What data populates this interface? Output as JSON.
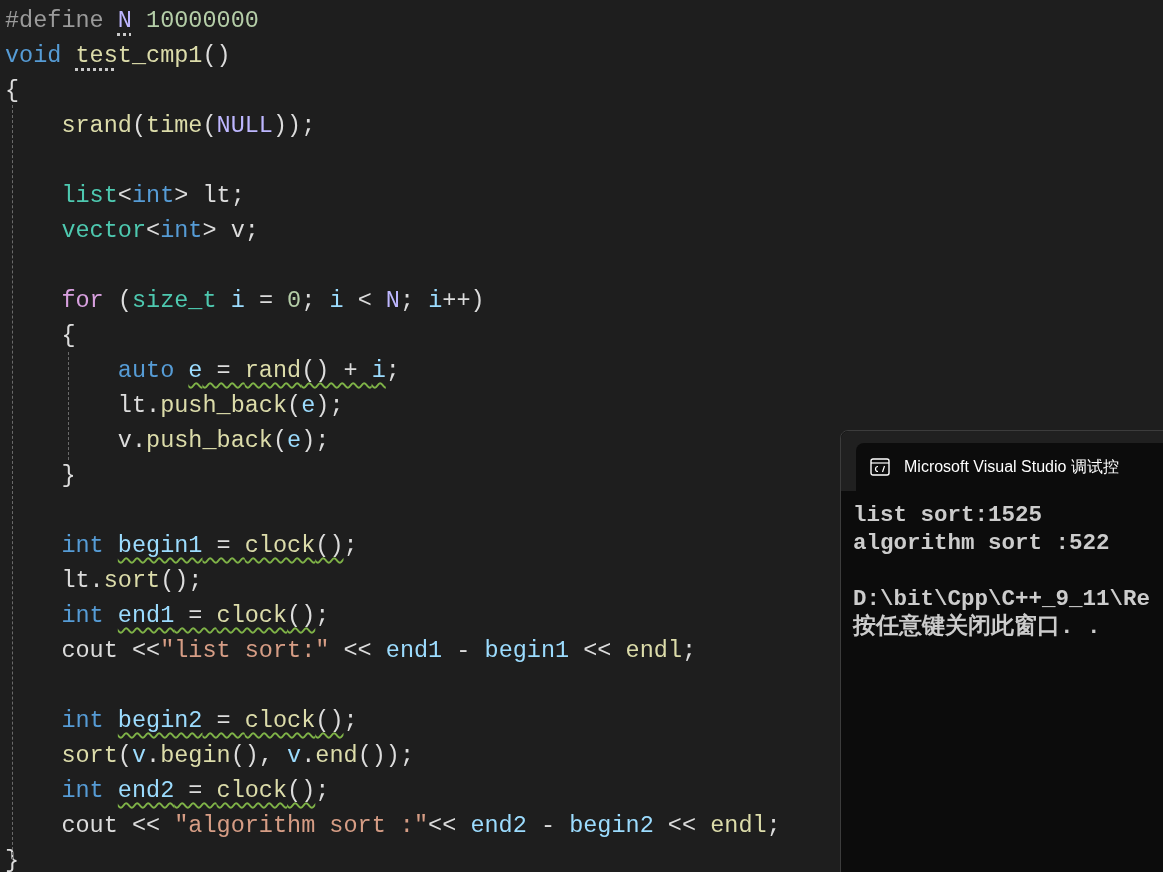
{
  "editor": {
    "lines": [
      {
        "kind": "code",
        "segments": [
          {
            "kind": "plain",
            "tokens": [
              {
                "text": "#define ",
                "kind": "preproc"
              }
            ]
          },
          {
            "kind": "hint",
            "tokens": [
              {
                "text": "N",
                "kind": "macro"
              }
            ]
          },
          {
            "kind": "plain",
            "tokens": [
              {
                "text": " 10000000",
                "kind": "number"
              }
            ]
          }
        ]
      },
      {
        "kind": "code",
        "segments": [
          {
            "kind": "plain",
            "tokens": [
              {
                "text": "void ",
                "kind": "keyword"
              }
            ]
          },
          {
            "kind": "hint",
            "tokens": [
              {
                "text": "tes",
                "kind": "func"
              }
            ]
          },
          {
            "kind": "plain",
            "tokens": [
              {
                "text": "t_cmp1",
                "kind": "func"
              },
              {
                "text": "()",
                "kind": "punct"
              }
            ]
          }
        ]
      },
      {
        "kind": "code",
        "segments": [
          {
            "kind": "plain",
            "tokens": [
              {
                "text": "{",
                "kind": "punct"
              }
            ]
          }
        ]
      },
      {
        "kind": "code",
        "segments": [
          {
            "kind": "plain",
            "tokens": [
              {
                "text": "    srand",
                "kind": "func"
              },
              {
                "text": "(",
                "kind": "punct"
              },
              {
                "text": "time",
                "kind": "func"
              },
              {
                "text": "(",
                "kind": "punct"
              },
              {
                "text": "NULL",
                "kind": "macro"
              },
              {
                "text": "));",
                "kind": "punct"
              }
            ]
          }
        ]
      },
      {
        "kind": "blank"
      },
      {
        "kind": "code",
        "segments": [
          {
            "kind": "plain",
            "tokens": [
              {
                "text": "    list",
                "kind": "type"
              },
              {
                "text": "<",
                "kind": "punct"
              },
              {
                "text": "int",
                "kind": "keyword"
              },
              {
                "text": "> lt;",
                "kind": "punct"
              }
            ]
          }
        ]
      },
      {
        "kind": "code",
        "segments": [
          {
            "kind": "plain",
            "tokens": [
              {
                "text": "    vector",
                "kind": "type"
              },
              {
                "text": "<",
                "kind": "punct"
              },
              {
                "text": "int",
                "kind": "keyword"
              },
              {
                "text": "> v;",
                "kind": "punct"
              }
            ]
          }
        ]
      },
      {
        "kind": "blank"
      },
      {
        "kind": "code",
        "segments": [
          {
            "kind": "plain",
            "tokens": [
              {
                "text": "    for",
                "kind": "control"
              },
              {
                "text": " (",
                "kind": "punct"
              },
              {
                "text": "size_t",
                "kind": "type"
              },
              {
                "text": " i",
                "kind": "var"
              },
              {
                "text": " = ",
                "kind": "punct"
              },
              {
                "text": "0",
                "kind": "number"
              },
              {
                "text": "; ",
                "kind": "punct"
              },
              {
                "text": "i",
                "kind": "var"
              },
              {
                "text": " < ",
                "kind": "punct"
              },
              {
                "text": "N",
                "kind": "macro"
              },
              {
                "text": "; ",
                "kind": "punct"
              },
              {
                "text": "i",
                "kind": "var"
              },
              {
                "text": "++)",
                "kind": "punct"
              }
            ]
          }
        ]
      },
      {
        "kind": "code",
        "segments": [
          {
            "kind": "plain",
            "tokens": [
              {
                "text": "    {",
                "kind": "punct"
              }
            ]
          }
        ]
      },
      {
        "kind": "code",
        "segments": [
          {
            "kind": "plain",
            "tokens": [
              {
                "text": "        auto ",
                "kind": "keyword"
              }
            ]
          },
          {
            "kind": "warning",
            "tokens": [
              {
                "text": "e",
                "kind": "var"
              },
              {
                "text": " = ",
                "kind": "punct"
              },
              {
                "text": "rand",
                "kind": "func"
              },
              {
                "text": "() + ",
                "kind": "punct"
              },
              {
                "text": "i",
                "kind": "var"
              }
            ]
          },
          {
            "kind": "plain",
            "tokens": [
              {
                "text": ";",
                "kind": "punct"
              }
            ]
          }
        ]
      },
      {
        "kind": "code",
        "segments": [
          {
            "kind": "plain",
            "tokens": [
              {
                "text": "        lt.",
                "kind": "punct"
              },
              {
                "text": "push_back",
                "kind": "func"
              },
              {
                "text": "(",
                "kind": "punct"
              },
              {
                "text": "e",
                "kind": "var"
              },
              {
                "text": ");",
                "kind": "punct"
              }
            ]
          }
        ]
      },
      {
        "kind": "code",
        "segments": [
          {
            "kind": "plain",
            "tokens": [
              {
                "text": "        v.",
                "kind": "punct"
              },
              {
                "text": "push_back",
                "kind": "func"
              },
              {
                "text": "(",
                "kind": "punct"
              },
              {
                "text": "e",
                "kind": "var"
              },
              {
                "text": ");",
                "kind": "punct"
              }
            ]
          }
        ]
      },
      {
        "kind": "code",
        "segments": [
          {
            "kind": "plain",
            "tokens": [
              {
                "text": "    }",
                "kind": "punct"
              }
            ]
          }
        ]
      },
      {
        "kind": "blank"
      },
      {
        "kind": "code",
        "segments": [
          {
            "kind": "plain",
            "tokens": [
              {
                "text": "    int ",
                "kind": "keyword"
              }
            ]
          },
          {
            "kind": "warning",
            "tokens": [
              {
                "text": "begin1",
                "kind": "var"
              },
              {
                "text": " = ",
                "kind": "punct"
              },
              {
                "text": "clock",
                "kind": "func"
              },
              {
                "text": "()",
                "kind": "punct"
              }
            ]
          },
          {
            "kind": "plain",
            "tokens": [
              {
                "text": ";",
                "kind": "punct"
              }
            ]
          }
        ]
      },
      {
        "kind": "code",
        "segments": [
          {
            "kind": "plain",
            "tokens": [
              {
                "text": "    lt.",
                "kind": "punct"
              },
              {
                "text": "sort",
                "kind": "func"
              },
              {
                "text": "();",
                "kind": "punct"
              }
            ]
          }
        ]
      },
      {
        "kind": "code",
        "segments": [
          {
            "kind": "plain",
            "tokens": [
              {
                "text": "    int ",
                "kind": "keyword"
              }
            ]
          },
          {
            "kind": "warning",
            "tokens": [
              {
                "text": "end1",
                "kind": "var"
              },
              {
                "text": " = ",
                "kind": "punct"
              },
              {
                "text": "clock",
                "kind": "func"
              },
              {
                "text": "()",
                "kind": "punct"
              }
            ]
          },
          {
            "kind": "plain",
            "tokens": [
              {
                "text": ";",
                "kind": "punct"
              }
            ]
          }
        ]
      },
      {
        "kind": "code",
        "segments": [
          {
            "kind": "plain",
            "tokens": [
              {
                "text": "    cout <<",
                "kind": "punct"
              },
              {
                "text": "\"list sort:\"",
                "kind": "string"
              },
              {
                "text": " << ",
                "kind": "punct"
              },
              {
                "text": "end1",
                "kind": "var"
              },
              {
                "text": " - ",
                "kind": "punct"
              },
              {
                "text": "begin1",
                "kind": "var"
              },
              {
                "text": " << ",
                "kind": "punct"
              },
              {
                "text": "endl",
                "kind": "func"
              },
              {
                "text": ";",
                "kind": "punct"
              }
            ]
          }
        ]
      },
      {
        "kind": "blank"
      },
      {
        "kind": "code",
        "segments": [
          {
            "kind": "plain",
            "tokens": [
              {
                "text": "    int ",
                "kind": "keyword"
              }
            ]
          },
          {
            "kind": "warning",
            "tokens": [
              {
                "text": "begin2",
                "kind": "var"
              },
              {
                "text": " = ",
                "kind": "punct"
              },
              {
                "text": "clock",
                "kind": "func"
              },
              {
                "text": "()",
                "kind": "punct"
              }
            ]
          },
          {
            "kind": "plain",
            "tokens": [
              {
                "text": ";",
                "kind": "punct"
              }
            ]
          }
        ]
      },
      {
        "kind": "code",
        "segments": [
          {
            "kind": "plain",
            "tokens": [
              {
                "text": "    sort",
                "kind": "func"
              },
              {
                "text": "(",
                "kind": "punct"
              },
              {
                "text": "v",
                "kind": "var"
              },
              {
                "text": ".",
                "kind": "punct"
              },
              {
                "text": "begin",
                "kind": "func"
              },
              {
                "text": "(), ",
                "kind": "punct"
              },
              {
                "text": "v",
                "kind": "var"
              },
              {
                "text": ".",
                "kind": "punct"
              },
              {
                "text": "end",
                "kind": "func"
              },
              {
                "text": "());",
                "kind": "punct"
              }
            ]
          }
        ]
      },
      {
        "kind": "code",
        "segments": [
          {
            "kind": "plain",
            "tokens": [
              {
                "text": "    int ",
                "kind": "keyword"
              }
            ]
          },
          {
            "kind": "warning",
            "tokens": [
              {
                "text": "end2",
                "kind": "var"
              },
              {
                "text": " = ",
                "kind": "punct"
              },
              {
                "text": "clock",
                "kind": "func"
              },
              {
                "text": "()",
                "kind": "punct"
              }
            ]
          },
          {
            "kind": "plain",
            "tokens": [
              {
                "text": ";",
                "kind": "punct"
              }
            ]
          }
        ]
      },
      {
        "kind": "code",
        "segments": [
          {
            "kind": "plain",
            "tokens": [
              {
                "text": "    cout << ",
                "kind": "punct"
              },
              {
                "text": "\"algorithm sort :\"",
                "kind": "string"
              },
              {
                "text": "<< ",
                "kind": "punct"
              },
              {
                "text": "end2",
                "kind": "var"
              },
              {
                "text": " - ",
                "kind": "punct"
              },
              {
                "text": "begin2",
                "kind": "var"
              },
              {
                "text": " << ",
                "kind": "punct"
              },
              {
                "text": "endl",
                "kind": "func"
              },
              {
                "text": ";",
                "kind": "punct"
              }
            ]
          }
        ]
      },
      {
        "kind": "code",
        "segments": [
          {
            "kind": "plain",
            "tokens": [
              {
                "text": "}",
                "kind": "punct"
              }
            ]
          }
        ]
      }
    ]
  },
  "console": {
    "tab_title": "Microsoft Visual Studio 调试控",
    "lines": [
      {
        "kind": "text",
        "text": "list sort:1525"
      },
      {
        "kind": "text",
        "text": "algorithm sort :522"
      },
      {
        "kind": "blank"
      },
      {
        "kind": "text",
        "text": "D:\\bit\\Cpp\\C++_9_11\\Re"
      },
      {
        "kind": "text",
        "text": "按任意键关闭此窗口. ."
      }
    ]
  }
}
